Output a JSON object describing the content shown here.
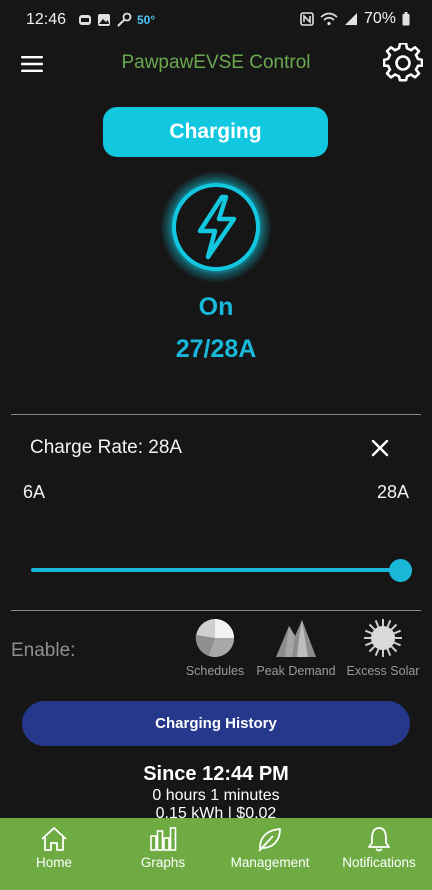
{
  "status_bar": {
    "time": "12:46",
    "temperature": "50°",
    "battery": "70%"
  },
  "header": {
    "title": "PawpawEVSE Control",
    "menu_icon": "hamburger-menu-icon",
    "settings_icon": "gear-icon"
  },
  "status": {
    "button_label": "Charging",
    "state": "On",
    "amps": "27/28A",
    "icon": "lightning-bolt-icon"
  },
  "charge_rate": {
    "label": "Charge Rate: 28A",
    "min_label": "6A",
    "max_label": "28A",
    "min_value": 6,
    "max_value": 28,
    "value": 28
  },
  "enable": {
    "label": "Enable:",
    "features": [
      {
        "label": "Schedules",
        "icon": "schedule-pie-icon"
      },
      {
        "label": "Peak Demand",
        "icon": "mountain-peak-icon"
      },
      {
        "label": "Excess Solar",
        "icon": "sun-icon"
      }
    ]
  },
  "history": {
    "button_label": "Charging History",
    "since": "Since 12:44 PM",
    "duration": "0 hours 1 minutes",
    "energy_cost": "0.15 kWh | $0.02"
  },
  "nav": {
    "items": [
      {
        "label": "Home",
        "icon": "home-icon"
      },
      {
        "label": "Graphs",
        "icon": "bar-chart-icon"
      },
      {
        "label": "Management",
        "icon": "leaf-icon"
      },
      {
        "label": "Notifications",
        "icon": "bell-icon"
      }
    ]
  },
  "colors": {
    "background": "#161616",
    "accent_cyan": "#12c8e0",
    "title_green": "#6aa84f",
    "nav_green": "#6eac43",
    "history_blue": "#26388b"
  }
}
